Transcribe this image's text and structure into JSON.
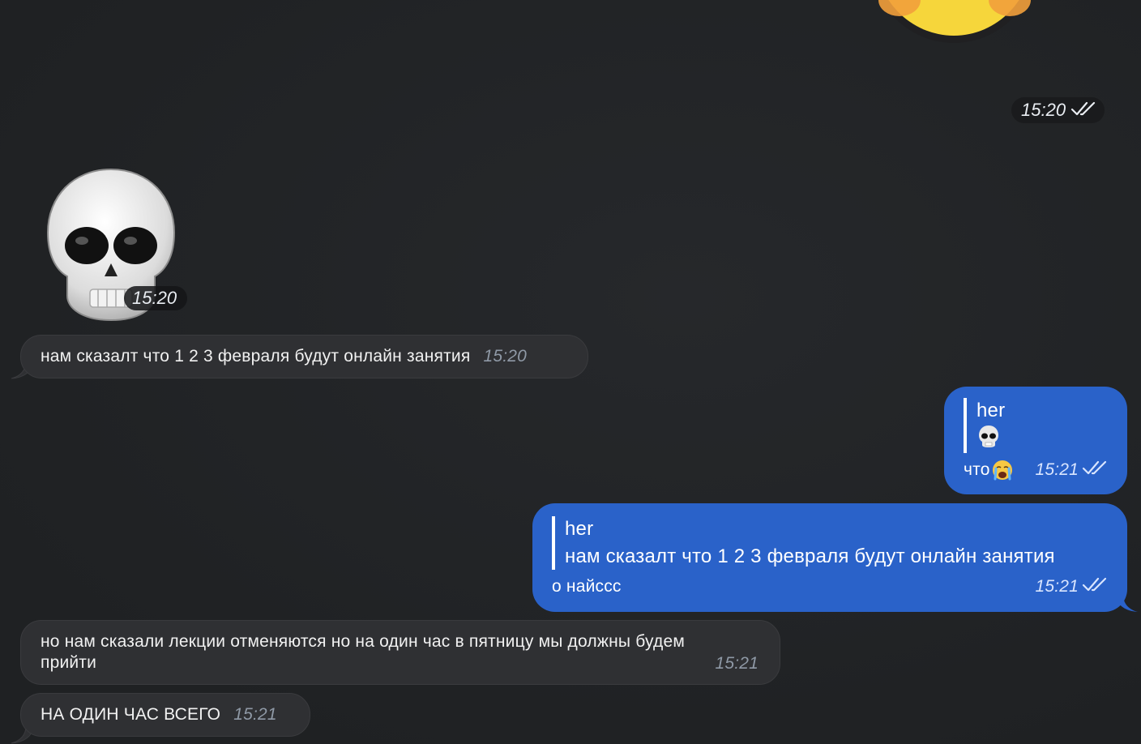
{
  "colors": {
    "background": "#222426",
    "incoming_bubble": "#2f3033",
    "outgoing_bubble": "#2a62c9",
    "time_pill": "#1a1b1d"
  },
  "sticker_top": {
    "icon": "smiley-sticker-icon",
    "time": "15:20",
    "status_icon": "double-check-icon"
  },
  "skull_sticker": {
    "icon": "skull-sticker-icon",
    "time": "15:20"
  },
  "messages": [
    {
      "direction": "incoming",
      "text": "нам сказалт что 1 2 3 февраля будут онлайн занятия",
      "time": "15:20"
    },
    {
      "direction": "outgoing",
      "reply_name": "her",
      "reply_preview_icon": "skull-emoji-icon",
      "text": "что",
      "trailing_icon": "crying-face-emoji-icon",
      "time": "15:21",
      "status_icon": "double-check-icon"
    },
    {
      "direction": "outgoing",
      "reply_name": "her",
      "reply_preview": "нам сказалт что 1 2 3 февраля будут онлайн занятия",
      "text": "о найссс",
      "time": "15:21",
      "status_icon": "double-check-icon"
    },
    {
      "direction": "incoming",
      "text": "но нам сказали лекции отменяются но на один час в пятницу мы должны будем прийти",
      "time": "15:21"
    },
    {
      "direction": "incoming",
      "text": "НА ОДИН ЧАС ВСЕГО",
      "time": "15:21"
    }
  ]
}
